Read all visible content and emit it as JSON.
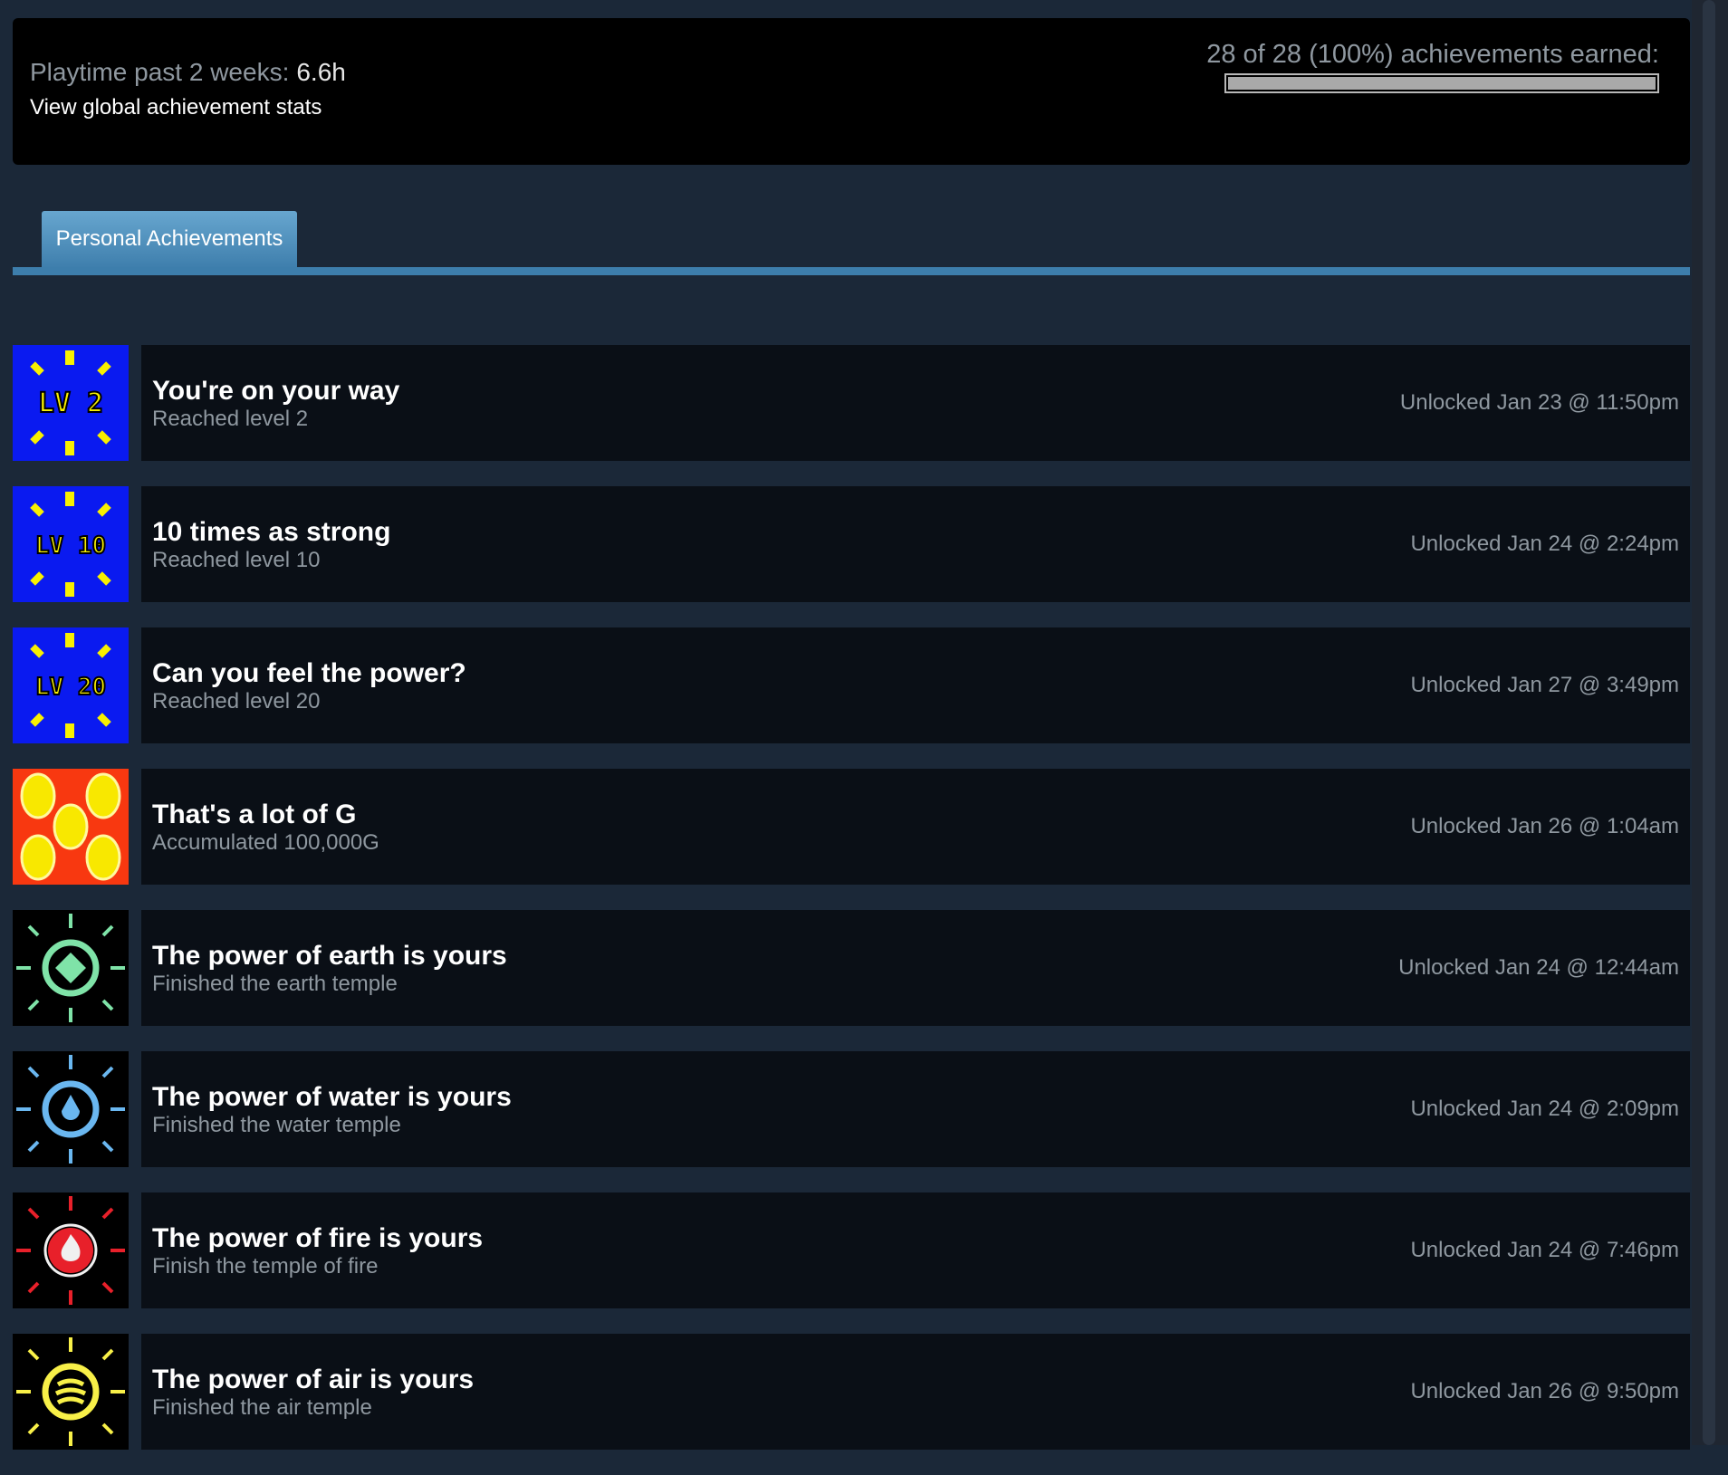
{
  "summary": {
    "playtime_label": "Playtime past 2 weeks:",
    "playtime_value": "6.6h",
    "global_stats_link": "View global achievement stats",
    "earned_text": "28 of 28 (100%) achievements earned:",
    "earned_progress": 1.0
  },
  "tabs": [
    {
      "label": "Personal Achievements",
      "active": true
    }
  ],
  "achievements": [
    {
      "icon": "level-2-badge-icon",
      "badge_text": "LV 2",
      "title": "You're on your way",
      "description": "Reached level 2",
      "unlocked": "Unlocked Jan 23 @ 11:50pm"
    },
    {
      "icon": "level-10-badge-icon",
      "badge_text": "LV 10",
      "title": "10 times as strong",
      "description": "Reached level 10",
      "unlocked": "Unlocked Jan 24 @ 2:24pm"
    },
    {
      "icon": "level-20-badge-icon",
      "badge_text": "LV 20",
      "title": "Can you feel the power?",
      "description": "Reached level 20",
      "unlocked": "Unlocked Jan 27 @ 3:49pm"
    },
    {
      "icon": "gold-coins-icon",
      "title": "That's a lot of G",
      "description": "Accumulated 100,000G",
      "unlocked": "Unlocked Jan 26 @ 1:04am"
    },
    {
      "icon": "earth-orb-icon",
      "title": "The power of earth is yours",
      "description": "Finished the earth temple",
      "unlocked": "Unlocked Jan 24 @ 12:44am"
    },
    {
      "icon": "water-orb-icon",
      "title": "The power of water is yours",
      "description": "Finished the water temple",
      "unlocked": "Unlocked Jan 24 @ 2:09pm"
    },
    {
      "icon": "fire-orb-icon",
      "title": "The power of fire is yours",
      "description": "Finish the temple of fire",
      "unlocked": "Unlocked Jan 24 @ 7:46pm"
    },
    {
      "icon": "air-orb-icon",
      "title": "The power of air is yours",
      "description": "Finished the air temple",
      "unlocked": "Unlocked Jan 26 @ 9:50pm"
    }
  ],
  "colors": {
    "page_bg": "#1b2838",
    "tab_bg": "#4b8bbe",
    "level_badge_bg": "#0a1af0",
    "level_badge_accent": "#f8f000",
    "coins_bg": "#f83810",
    "earth": "#7fe3a8",
    "water": "#6ab7f0",
    "fire": "#e8202a",
    "air": "#f8f048"
  }
}
